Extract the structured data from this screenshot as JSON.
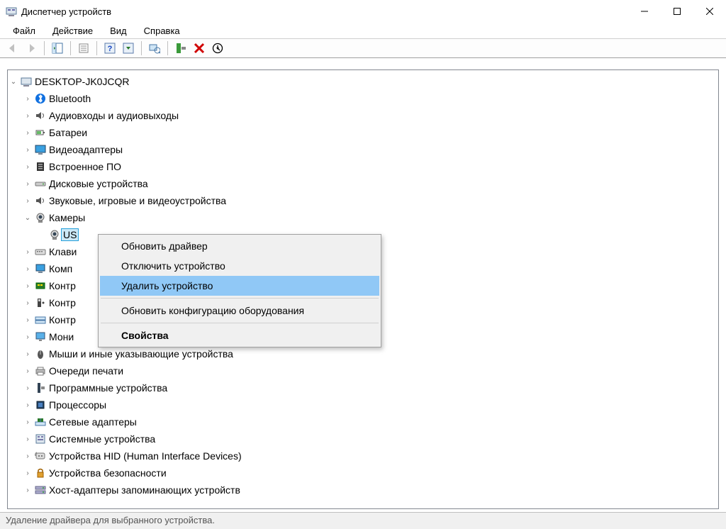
{
  "window": {
    "title": "Диспетчер устройств"
  },
  "menu": {
    "file": "Файл",
    "action": "Действие",
    "view": "Вид",
    "help": "Справка"
  },
  "tree": {
    "root": "DESKTOP-JK0JCQR",
    "cats": [
      {
        "label": "Bluetooth",
        "icon": "bt"
      },
      {
        "label": "Аудиовходы и аудиовыходы",
        "icon": "audio"
      },
      {
        "label": "Батареи",
        "icon": "battery"
      },
      {
        "label": "Видеоадаптеры",
        "icon": "display"
      },
      {
        "label": "Встроенное ПО",
        "icon": "firmware"
      },
      {
        "label": "Дисковые устройства",
        "icon": "disk"
      },
      {
        "label": "Звуковые, игровые и видеоустройства",
        "icon": "audio"
      },
      {
        "label": "Камеры",
        "icon": "camera",
        "expanded": true,
        "children": [
          {
            "label": "US",
            "icon": "camera",
            "selected": true
          }
        ]
      },
      {
        "label": "Клави",
        "icon": "keyboard"
      },
      {
        "label": "Комп",
        "icon": "computer"
      },
      {
        "label": "Контр",
        "icon": "controller-pci"
      },
      {
        "label": "Контр",
        "icon": "usb"
      },
      {
        "label": "Контр",
        "icon": "storage"
      },
      {
        "label": "Мони",
        "icon": "monitor"
      },
      {
        "label": "Мыши и иные указывающие устройства",
        "icon": "mouse"
      },
      {
        "label": "Очереди печати",
        "icon": "printer"
      },
      {
        "label": "Программные устройства",
        "icon": "software"
      },
      {
        "label": "Процессоры",
        "icon": "cpu"
      },
      {
        "label": "Сетевые адаптеры",
        "icon": "network"
      },
      {
        "label": "Системные устройства",
        "icon": "system"
      },
      {
        "label": "Устройства HID (Human Interface Devices)",
        "icon": "hid"
      },
      {
        "label": "Устройства безопасности",
        "icon": "security"
      },
      {
        "label": "Хост-адаптеры запоминающих устройств",
        "icon": "host-storage"
      }
    ]
  },
  "context_menu": {
    "items": [
      {
        "label": "Обновить драйвер",
        "highlight": false
      },
      {
        "label": "Отключить устройство",
        "highlight": false
      },
      {
        "label": "Удалить устройство",
        "highlight": true
      },
      {
        "sep": true
      },
      {
        "label": "Обновить конфигурацию оборудования"
      },
      {
        "sep": true
      },
      {
        "label": "Свойства",
        "bold": true
      }
    ]
  },
  "status": "Удаление драйвера для выбранного устройства."
}
